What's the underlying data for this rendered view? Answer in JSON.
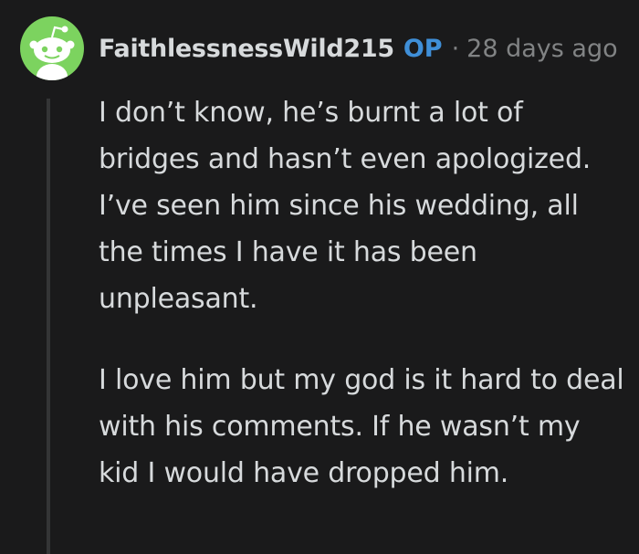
{
  "comment": {
    "username": "FaithlessnessWild215",
    "badge": "OP",
    "separator": "·",
    "timestamp": "28 days ago",
    "avatar_icon": "reddit-snoo-avatar-icon",
    "paragraphs": [
      "I don’t know, he’s burnt a lot of bridges and hasn’t even apologized. I’ve seen him since his wedding, all the times I have it has been unpleasant.",
      "I love him but my god is it hard to deal with his comments. If he wasn’t my kid I would have dropped him."
    ]
  },
  "colors": {
    "background": "#1a1a1b",
    "text": "#d7dadc",
    "muted": "#818384",
    "op_blue": "#3f8fd8",
    "avatar_green": "#7cd35f",
    "thread_line": "#343536"
  }
}
